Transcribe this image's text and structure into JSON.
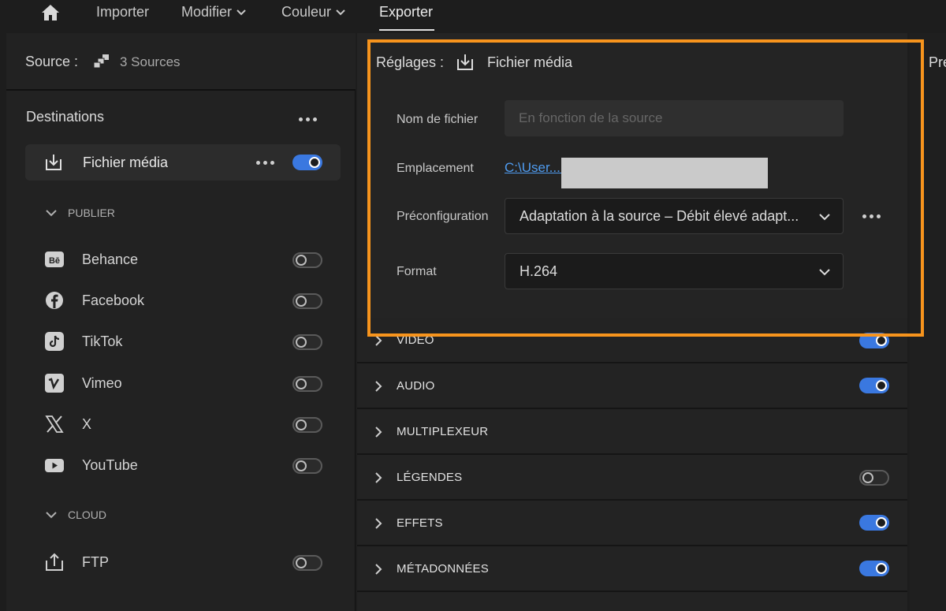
{
  "nav": {
    "items": [
      "Importer",
      "Modifier",
      "Couleur",
      "Exporter"
    ],
    "active": "Exporter"
  },
  "source": {
    "label": "Source :",
    "count": "3 Sources"
  },
  "destinations": {
    "title": "Destinations",
    "media_file": "Fichier média",
    "media_file_enabled": true,
    "publish_header": "PUBLIER",
    "publish": [
      {
        "name": "Behance",
        "icon": "behance-icon",
        "enabled": false
      },
      {
        "name": "Facebook",
        "icon": "facebook-icon",
        "enabled": false
      },
      {
        "name": "TikTok",
        "icon": "tiktok-icon",
        "enabled": false
      },
      {
        "name": "Vimeo",
        "icon": "vimeo-icon",
        "enabled": false
      },
      {
        "name": "X",
        "icon": "x-icon",
        "enabled": false
      },
      {
        "name": "YouTube",
        "icon": "youtube-icon",
        "enabled": false
      }
    ],
    "cloud_header": "CLOUD",
    "cloud": [
      {
        "name": "FTP",
        "icon": "upload-icon",
        "enabled": false
      }
    ]
  },
  "settings": {
    "label": "Réglages :",
    "value": "Fichier média",
    "filename_label": "Nom de fichier",
    "filename_placeholder": "En fonction de la source",
    "location_label": "Emplacement",
    "location_value": "C:\\User...b",
    "preset_label": "Préconfiguration",
    "preset_value": "Adaptation à la source – Débit élevé adapt...",
    "format_label": "Format",
    "format_value": "H.264"
  },
  "sections": [
    {
      "label": "VIDEO",
      "toggle": true
    },
    {
      "label": "AUDIO",
      "toggle": true
    },
    {
      "label": "MULTIPLEXEUR",
      "toggle": null
    },
    {
      "label": "LÉGENDES",
      "toggle": false
    },
    {
      "label": "EFFETS",
      "toggle": true
    },
    {
      "label": "MÉTADONNÉES",
      "toggle": true
    }
  ],
  "right_panel": {
    "label": "Pré"
  },
  "colors": {
    "accent": "#3a78e0",
    "highlight": "#f7941d",
    "link": "#4f9cf0"
  }
}
